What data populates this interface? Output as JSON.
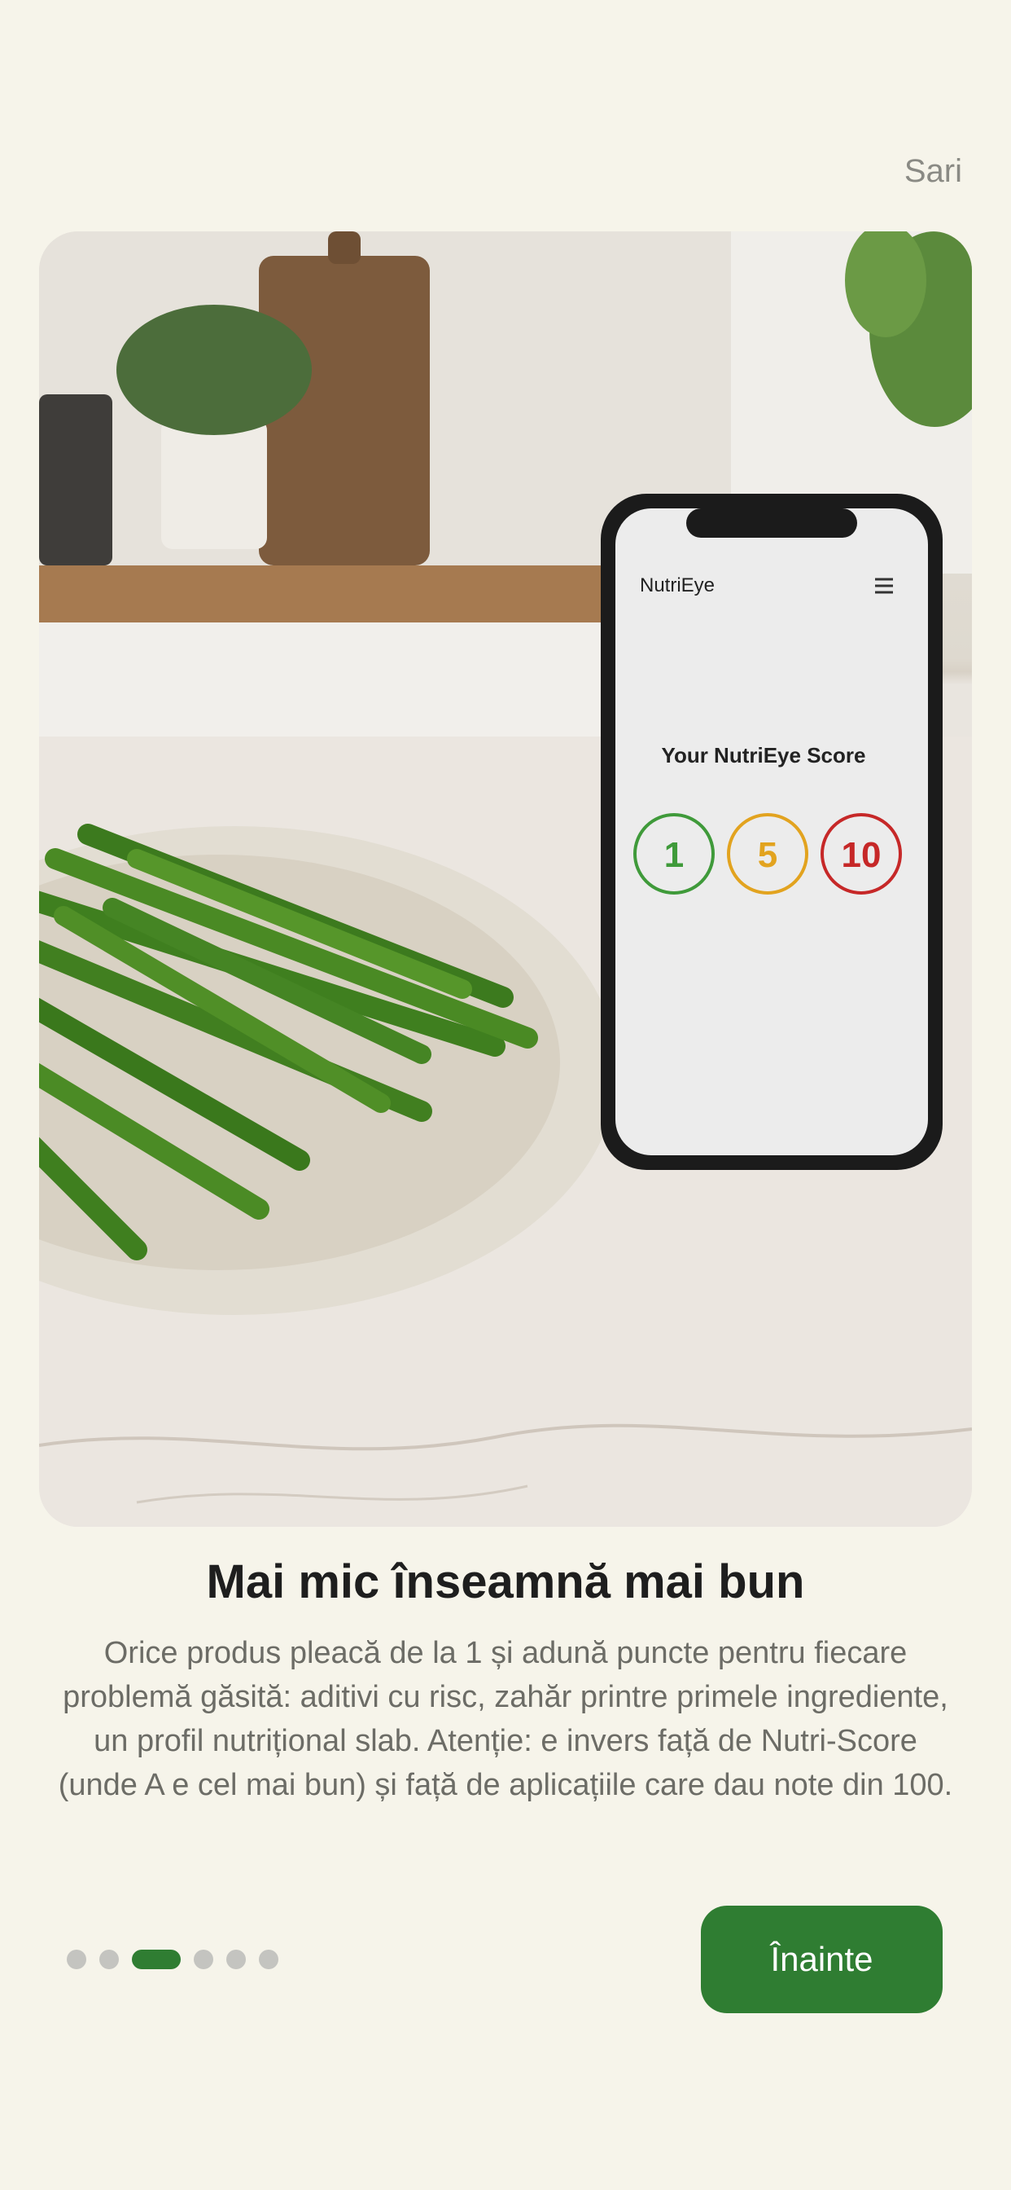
{
  "header": {
    "skip_label": "Sari"
  },
  "hero": {
    "app_name": "NutriEye",
    "score_title": "Your NutriEye Score",
    "scores": [
      {
        "value": "1",
        "color": "#3f9a3a"
      },
      {
        "value": "5",
        "color": "#e2a31f"
      },
      {
        "value": "10",
        "color": "#c62828"
      }
    ]
  },
  "content": {
    "title": "Mai mic înseamnă mai bun",
    "description": "Orice produs pleacă de la 1 și adună puncte pentru fiecare problemă găsită: aditivi cu risc, zahăr printre primele ingrediente, un profil nutrițional slab. Atenție: e invers față de Nutri-Score (unde A e cel mai bun) și față de aplicațiile care dau note din 100."
  },
  "pagination": {
    "total": 6,
    "active_index": 2
  },
  "actions": {
    "next_label": "Înainte"
  },
  "colors": {
    "accent": "#2f7d32",
    "background": "#f6f4ea"
  }
}
